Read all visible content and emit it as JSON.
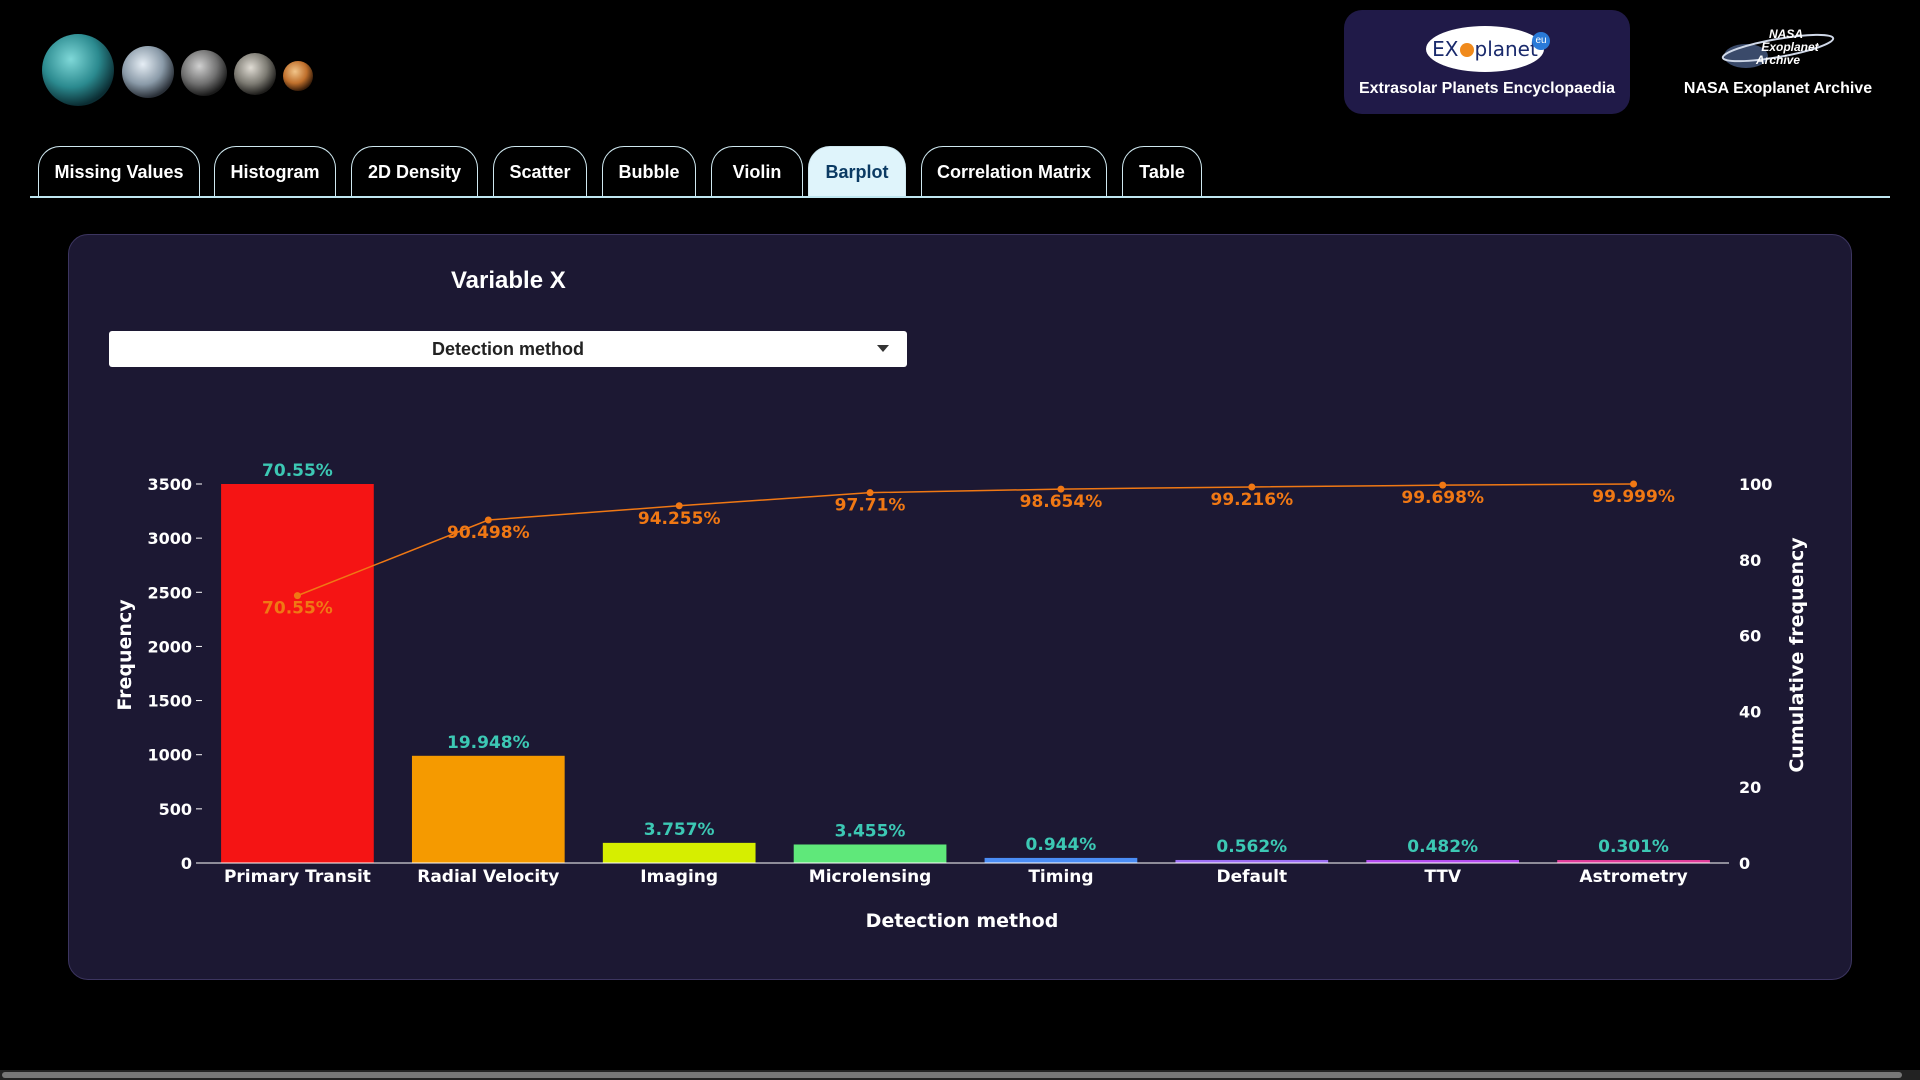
{
  "header": {
    "exoplanet_logo_text": "EXoplanet",
    "exoplanet_logo_badge": "eu",
    "exoplanet_caption": "Extrasolar Planets Encyclopaedia",
    "nasa_logo_text": "NASA Exoplanet Archive",
    "nasa_caption": "NASA Exoplanet Archive"
  },
  "tabs": [
    {
      "label": "Missing Values"
    },
    {
      "label": "Histogram"
    },
    {
      "label": "2D Density"
    },
    {
      "label": "Scatter"
    },
    {
      "label": "Bubble"
    },
    {
      "label": "Violin"
    },
    {
      "label": "Barplot",
      "active": true
    },
    {
      "label": "Correlation Matrix"
    },
    {
      "label": "Table"
    }
  ],
  "controls": {
    "variable_label": "Variable X",
    "dropdown_value": "Detection method"
  },
  "chart_data": {
    "type": "bar",
    "xlabel": "Detection method",
    "ylabel": "Frequency",
    "y2label": "Cumulative frequency",
    "ylim": [
      0,
      3500
    ],
    "y2lim": [
      0,
      100
    ],
    "yticks": [
      0,
      500,
      1000,
      1500,
      2000,
      2500,
      3000,
      3500
    ],
    "y2ticks": [
      0,
      20,
      40,
      60,
      80,
      100
    ],
    "grid": false,
    "categories": [
      "Primary Transit",
      "Radial Velocity",
      "Imaging",
      "Microlensing",
      "Timing",
      "Default",
      "TTV",
      "Astrometry"
    ],
    "values": [
      3500,
      990,
      186,
      171,
      47,
      28,
      24,
      15
    ],
    "percent_labels": [
      "70.55%",
      "19.948%",
      "3.757%",
      "3.455%",
      "0.944%",
      "0.562%",
      "0.482%",
      "0.301%"
    ],
    "bar_colors": [
      "#f51414",
      "#f59a00",
      "#d6ee00",
      "#5fe87a",
      "#4b8df5",
      "#9d6ff5",
      "#b54cf0",
      "#e03c9a"
    ],
    "cumulative": [
      70.55,
      90.498,
      94.255,
      97.71,
      98.654,
      99.216,
      99.698,
      99.999
    ],
    "cumulative_labels": [
      "70.55%",
      "90.498%",
      "94.255%",
      "97.71%",
      "98.654%",
      "99.216%",
      "99.698%",
      "99.999%"
    ],
    "percent_label_color": "#3cc8b4",
    "cumulative_color": "#f07814"
  }
}
